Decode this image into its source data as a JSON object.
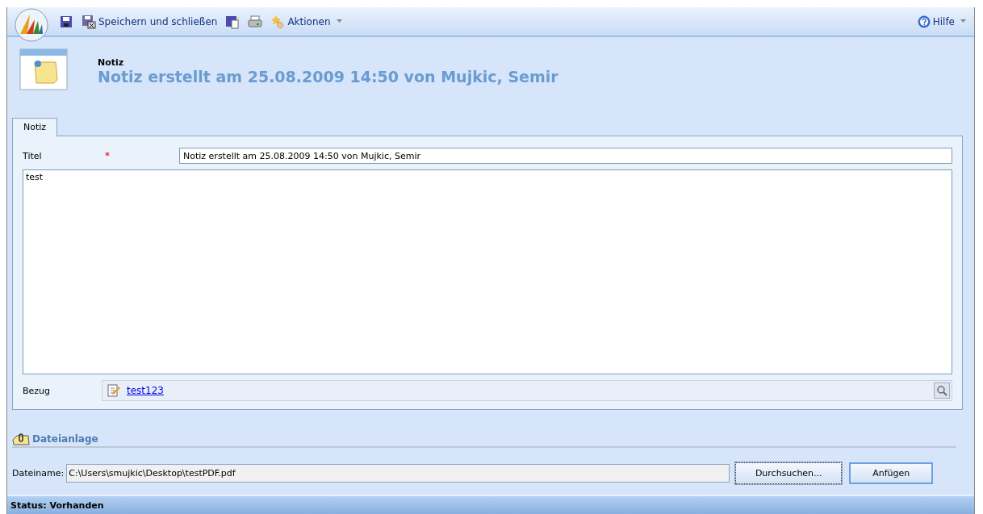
{
  "toolbar": {
    "items": [
      {
        "kind": "save"
      },
      {
        "kind": "save_close",
        "label": "Speichern und schließen"
      },
      {
        "kind": "save_new"
      },
      {
        "kind": "print"
      },
      {
        "kind": "actions",
        "label": "Aktionen"
      }
    ],
    "help": {
      "label": "Hilfe"
    }
  },
  "header": {
    "entity": "Notiz",
    "title": "Notiz erstellt am 25.08.2009 14:50 von Mujkic, Semir"
  },
  "tabs": [
    {
      "label": "Notiz",
      "selected": true
    }
  ],
  "form": {
    "title_label": "Titel",
    "required_mark": "*",
    "title_value": "Notiz erstellt am 25.08.2009 14:50 von Mujkic, Semir",
    "body": "test",
    "regarding_label": "Bezug",
    "regarding_link": "test123"
  },
  "attachment": {
    "heading": "Dateianlage",
    "filename_label": "Dateiname:",
    "filename_value": "C:\\Users\\smujkic\\Desktop\\testPDF.pdf",
    "browse_button": "Durchsuchen...",
    "attach_button": "Anfügen"
  },
  "status_bar": "Status: Vorhanden"
}
